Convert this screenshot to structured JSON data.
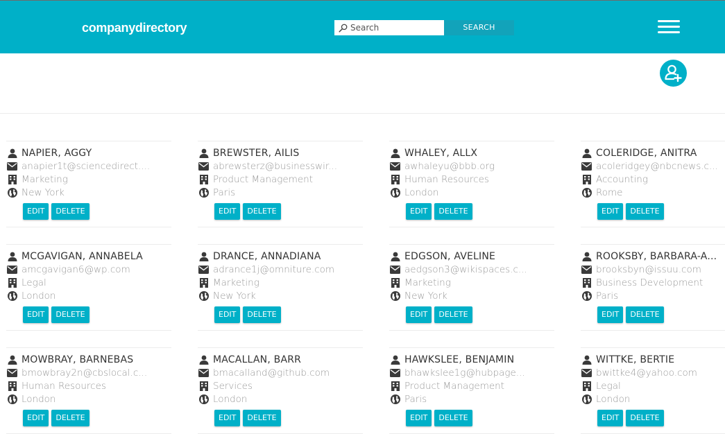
{
  "brand": "companydirectory",
  "search": {
    "placeholder": "Search",
    "button": "SEARCH"
  },
  "actions": {
    "edit": "EDIT",
    "delete": "DELETE"
  },
  "colors": {
    "accent": "#00b0c8",
    "text": "#333333",
    "muted": "#9a9a9a"
  },
  "icons": {
    "name": "person-icon",
    "email": "envelope-icon",
    "department": "building-icon",
    "location": "globe-icon",
    "add": "add-user-icon",
    "menu": "hamburger-icon"
  },
  "employees": [
    {
      "name": "NAPIER, AGGY",
      "email": "anapier1t@sciencedirect....",
      "department": "Marketing",
      "location": "New York"
    },
    {
      "name": "BREWSTER, AILIS",
      "email": "abrewsterz@businesswir...",
      "department": "Product Management",
      "location": "Paris"
    },
    {
      "name": "WHALEY, ALLX",
      "email": "awhaleyu@bbb.org",
      "department": "Human Resources",
      "location": "London"
    },
    {
      "name": "COLERIDGE, ANITRA",
      "email": "acoleridgey@nbcnews.c...",
      "department": "Accounting",
      "location": "Rome"
    },
    {
      "name": "MCGAVIGAN, ANNABELA",
      "email": "amcgavigan6@wp.com",
      "department": "Legal",
      "location": "London"
    },
    {
      "name": "DRANCE, ANNADIANA",
      "email": "adrance1j@omniture.com",
      "department": "Marketing",
      "location": "New York"
    },
    {
      "name": "EDGSON, AVELINE",
      "email": "aedgson3@wikispaces.c...",
      "department": "Marketing",
      "location": "New York"
    },
    {
      "name": "ROOKSBY, BARBARA-A...",
      "email": "brooksbyn@issuu.com",
      "department": "Business Development",
      "location": "Paris"
    },
    {
      "name": "MOWBRAY, BARNEBAS",
      "email": "bmowbray2n@cbslocal.c...",
      "department": "Human Resources",
      "location": "London"
    },
    {
      "name": "MACALLAN, BARR",
      "email": "bmacalland@github.com",
      "department": "Services",
      "location": "London"
    },
    {
      "name": "HAWKSLEE, BENJAMIN",
      "email": "bhawkslee1g@hubpage...",
      "department": "Product Management",
      "location": "Paris"
    },
    {
      "name": "WITTKE, BERTIE",
      "email": "bwittke4@yahoo.com",
      "department": "Legal",
      "location": "London"
    }
  ]
}
